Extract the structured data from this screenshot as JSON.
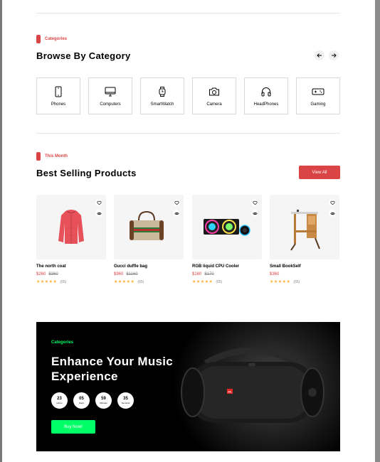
{
  "categories_section": {
    "tag": "Categories",
    "title": "Browse By Category",
    "items": [
      {
        "label": "Phones",
        "icon": "phone-icon"
      },
      {
        "label": "Computers",
        "icon": "computer-icon"
      },
      {
        "label": "SmartWatch",
        "icon": "smartwatch-icon"
      },
      {
        "label": "Camera",
        "icon": "camera-icon"
      },
      {
        "label": "HeadPhones",
        "icon": "headphones-icon"
      },
      {
        "label": "Gaming",
        "icon": "gamepad-icon"
      }
    ]
  },
  "best_selling": {
    "tag": "This Month",
    "title": "Best Selling Products",
    "view_all": "View All",
    "products": [
      {
        "name": "The north coat",
        "price": "$260",
        "old_price": "$360",
        "stars": "★★★★★",
        "reviews": "(65)"
      },
      {
        "name": "Gucci duffle bag",
        "price": "$960",
        "old_price": "$1160",
        "stars": "★★★★★",
        "reviews": "(65)"
      },
      {
        "name": "RGB liquid CPU Cooler",
        "price": "$160",
        "old_price": "$170",
        "stars": "★★★★★",
        "reviews": "(65)"
      },
      {
        "name": "Small BookSelf",
        "price": "$360",
        "old_price": "",
        "stars": "★★★★★",
        "reviews": "(65)"
      }
    ]
  },
  "banner": {
    "tag": "Categories",
    "title": "Enhance Your Music Experience",
    "timer": [
      {
        "value": "23",
        "unit": "Hours"
      },
      {
        "value": "05",
        "unit": "Days"
      },
      {
        "value": "59",
        "unit": "Minutes"
      },
      {
        "value": "35",
        "unit": "Seconds"
      }
    ],
    "button": "Buy Now!",
    "speaker_brand": "JBL"
  },
  "colors": {
    "accent": "#db4444",
    "green": "#00ff66",
    "star": "#ffad33"
  }
}
